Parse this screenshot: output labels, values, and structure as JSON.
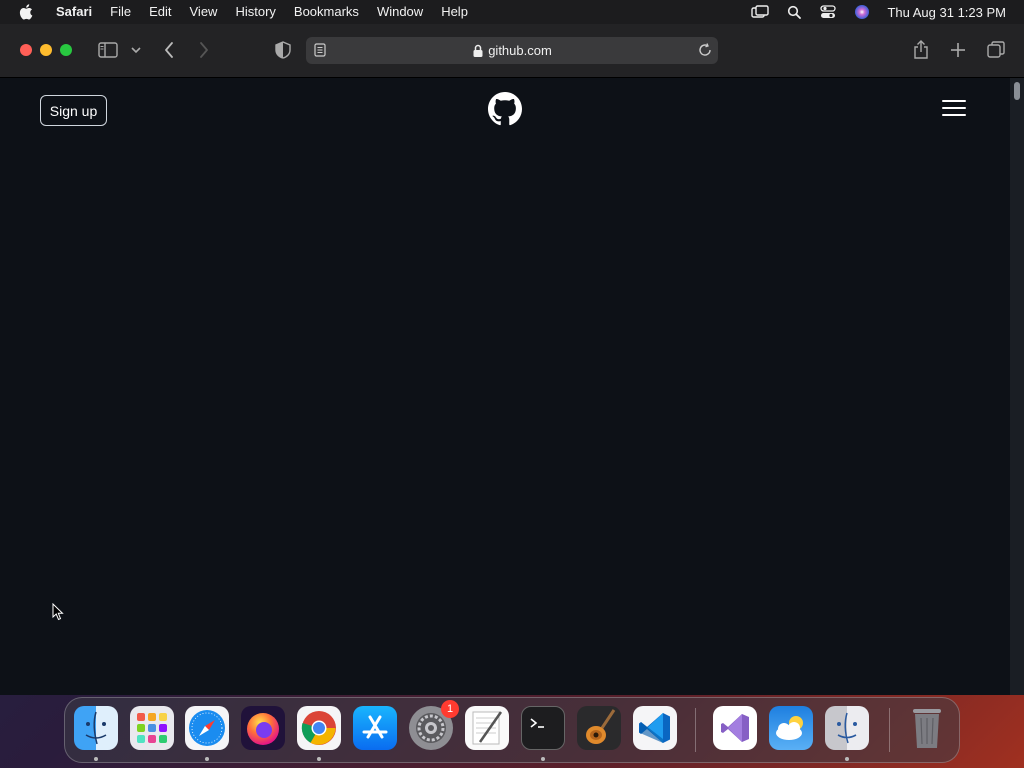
{
  "menubar": {
    "app_name": "Safari",
    "items": [
      "File",
      "Edit",
      "View",
      "History",
      "Bookmarks",
      "Window",
      "Help"
    ],
    "clock": "Thu Aug 31  1:23 PM"
  },
  "browser": {
    "url": "github.com"
  },
  "page": {
    "signup_label": "Sign up"
  },
  "dock": {
    "apps": [
      "finder-icon",
      "launchpad-icon",
      "safari-icon",
      "firefox-icon",
      "chrome-icon",
      "app-store-icon",
      "system-settings-icon",
      "textedit-icon",
      "terminal-icon",
      "garageband-icon",
      "vscode-icon",
      "visual-studio-icon",
      "weather-icon",
      "migration-assistant-icon",
      "trash-icon"
    ],
    "settings_badge": "1"
  },
  "colors": {
    "page_bg": "#0d1117",
    "toolbar_bg": "#232325",
    "menubar_bg": "#1c1c1e"
  }
}
